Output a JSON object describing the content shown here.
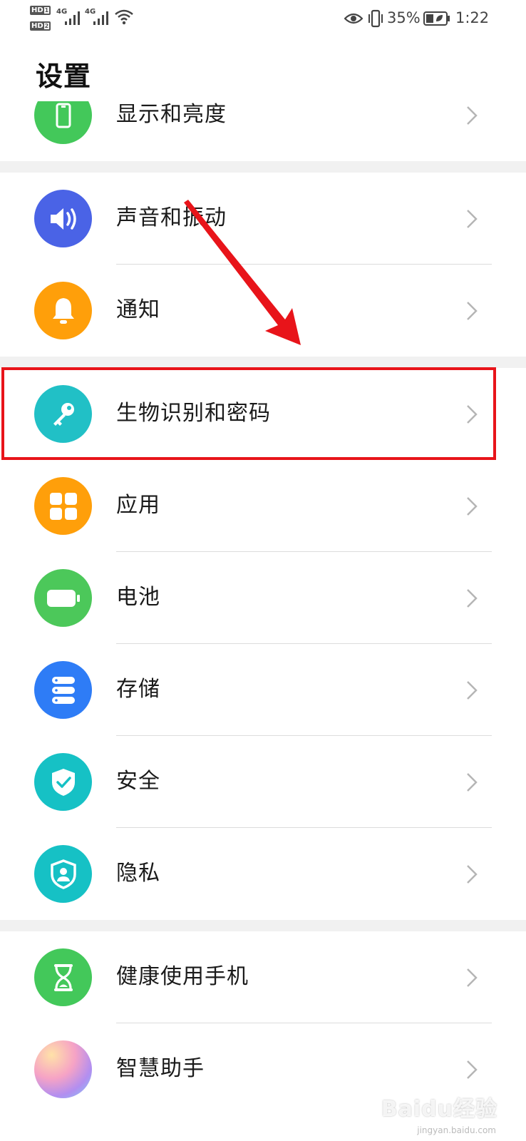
{
  "status_bar": {
    "hd1": "HD",
    "hd1_sub": "1",
    "hd2": "HD",
    "hd2_sub": "2",
    "net1": "4G",
    "net2": "4G",
    "battery_percent": "35%",
    "time": "1:22"
  },
  "page_title": "设置",
  "settings": {
    "display_partial": {
      "label": "显示和亮度",
      "icon": "phone-icon",
      "color": "#43c85a"
    },
    "sound": {
      "label": "声音和振动",
      "icon": "speaker-icon",
      "color": "#4a63e6"
    },
    "notification": {
      "label": "通知",
      "icon": "bell-icon",
      "color": "#ff9f0a"
    },
    "biometrics": {
      "label": "生物识别和密码",
      "icon": "key-icon",
      "color": "#21c0c6"
    },
    "apps": {
      "label": "应用",
      "icon": "apps-grid-icon",
      "color": "#ff9f0a"
    },
    "battery": {
      "label": "电池",
      "icon": "battery-icon",
      "color": "#4cc85a"
    },
    "storage": {
      "label": "存储",
      "icon": "storage-icon",
      "color": "#2e7cf6"
    },
    "security": {
      "label": "安全",
      "icon": "shield-check-icon",
      "color": "#16c1c5"
    },
    "privacy": {
      "label": "隐私",
      "icon": "shield-person-icon",
      "color": "#16c1c5"
    },
    "digital_balance": {
      "label": "健康使用手机",
      "icon": "hourglass-icon",
      "color": "#43c85a"
    },
    "assistant": {
      "label": "智慧助手",
      "icon": "assistant-gradient-icon",
      "color": "#d88ab0"
    }
  },
  "annotation": {
    "arrow_color": "#e8141a",
    "box_color": "#e8141a"
  },
  "watermark": {
    "brand": "Baidu经验",
    "url": "jingyan.baidu.com"
  }
}
